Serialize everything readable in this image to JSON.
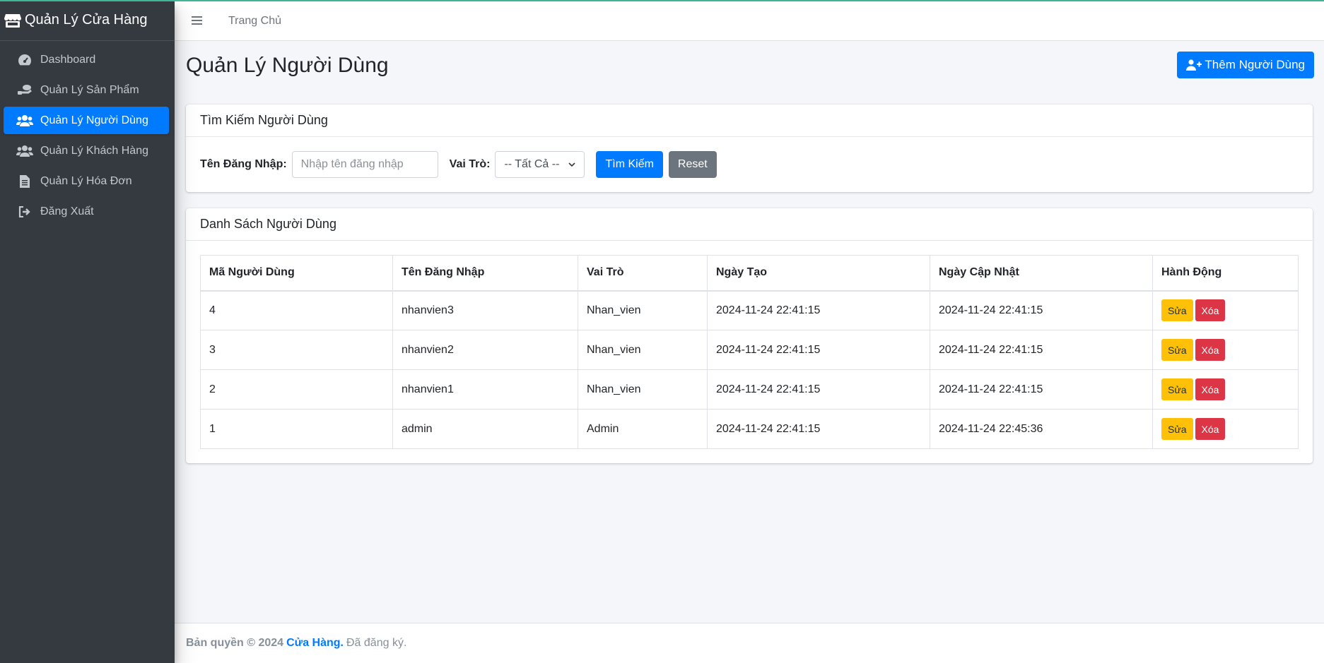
{
  "brand": {
    "title": "Quản Lý Cửa Hàng",
    "icon": "store-icon"
  },
  "sidebar": {
    "items": [
      {
        "label": "Dashboard",
        "icon": "tachometer-icon",
        "active": false
      },
      {
        "label": "Quản Lý Sản Phẩm",
        "icon": "boxes-icon",
        "active": false
      },
      {
        "label": "Quản Lý Người Dùng",
        "icon": "users-icon",
        "active": true
      },
      {
        "label": "Quản Lý Khách Hàng",
        "icon": "users-icon",
        "active": false
      },
      {
        "label": "Quản Lý Hóa Đơn",
        "icon": "file-invoice-icon",
        "active": false
      },
      {
        "label": "Đăng Xuất",
        "icon": "sign-out-icon",
        "active": false
      }
    ]
  },
  "topbar": {
    "home_link": "Trang Chủ"
  },
  "page": {
    "title": "Quản Lý Người Dùng",
    "add_button": "Thêm Người Dùng"
  },
  "search": {
    "header": "Tìm Kiếm Người Dùng",
    "username_label": "Tên Đăng Nhập:",
    "username_placeholder": "Nhập tên đăng nhập",
    "username_value": "",
    "role_label": "Vai Trò:",
    "role_selected": "-- Tất Cả --",
    "search_button": "Tìm Kiếm",
    "reset_button": "Reset"
  },
  "list": {
    "header": "Danh Sách Người Dùng",
    "columns": [
      "Mã Người Dùng",
      "Tên Đăng Nhập",
      "Vai Trò",
      "Ngày Tạo",
      "Ngày Cập Nhật",
      "Hành Động"
    ],
    "rows": [
      {
        "id": "4",
        "username": "nhanvien3",
        "role": "Nhan_vien",
        "created": "2024-11-24 22:41:15",
        "updated": "2024-11-24 22:41:15"
      },
      {
        "id": "3",
        "username": "nhanvien2",
        "role": "Nhan_vien",
        "created": "2024-11-24 22:41:15",
        "updated": "2024-11-24 22:41:15"
      },
      {
        "id": "2",
        "username": "nhanvien1",
        "role": "Nhan_vien",
        "created": "2024-11-24 22:41:15",
        "updated": "2024-11-24 22:41:15"
      },
      {
        "id": "1",
        "username": "admin",
        "role": "Admin",
        "created": "2024-11-24 22:41:15",
        "updated": "2024-11-24 22:45:36"
      }
    ],
    "edit_label": "Sửa",
    "delete_label": "Xóa"
  },
  "footer": {
    "copyright": "Bản quyền © 2024",
    "company": "Cửa Hàng.",
    "rights": "Đã đăng ký."
  },
  "colors": {
    "sidebar_bg": "#343a40",
    "primary": "#007bff",
    "secondary": "#6c757d",
    "warning": "#ffc107",
    "danger": "#dc3545",
    "accent_line": "#3fb59a"
  }
}
